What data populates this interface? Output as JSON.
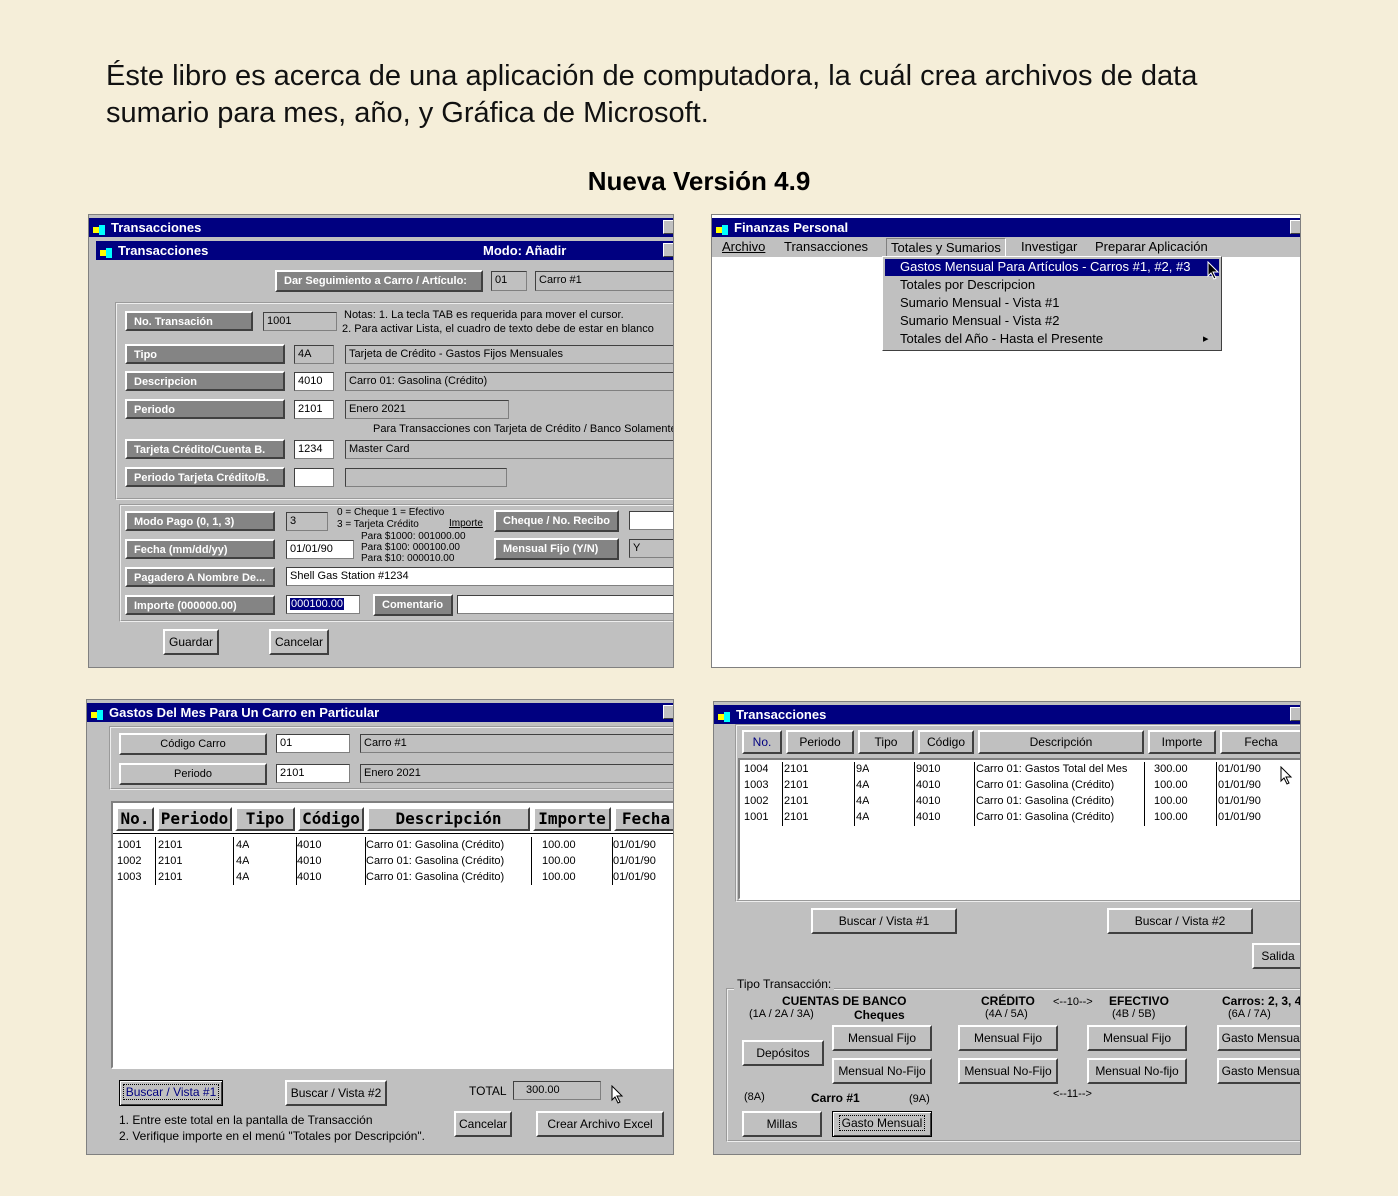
{
  "intro": {
    "line1": "Éste libro es acerca de una aplicación de computadora, la cuál crea archivos de data",
    "line2": "sumario para mes, año, y Gráfica de Microsoft."
  },
  "version": "Nueva Versión 4.9",
  "w1": {
    "outer_title": "Transacciones",
    "inner_title": "Transacciones",
    "mode": "Modo: Añadir",
    "seguimiento_label": "Dar Seguimiento a Carro / Artículo:",
    "seguimiento_code": "01",
    "seguimiento_name": "Carro #1",
    "no_trans_label": "No. Transación",
    "no_trans_value": "1001",
    "notes1": "Notas:  1.  La tecla TAB es requerida para mover el cursor.",
    "notes2": "2. Para activar Lista, el cuadro de texto debe de estar en blanco",
    "tipo_label": "Tipo",
    "tipo_code": "4A",
    "tipo_desc": "Tarjeta de Crédito - Gastos Fijos Mensuales",
    "desc_label": "Descripcion",
    "desc_code": "4010",
    "desc_value": "Carro 01: Gasolina  (Crédito)",
    "periodo_label": "Periodo",
    "periodo_code": "2101",
    "periodo_value": "Enero 2021",
    "tarjeta_note": "Para Transacciones con Tarjeta de Crédito / Banco Solamente",
    "tarjeta_label": "Tarjeta Crédito/Cuenta B.",
    "tarjeta_code": "1234",
    "tarjeta_value": "Master Card",
    "periodo_tarjeta_label": "Periodo Tarjeta Crédito/B.",
    "modo_pago_label": "Modo Pago (0, 1, 3)",
    "modo_pago_value": "3",
    "modo_note1": "0 = Cheque  1 = Efectivo",
    "modo_note2": "3 = Tarjeta Crédito",
    "importe_link": "Importe",
    "cheque_label": "Cheque / No. Recibo",
    "fecha_label": "Fecha  (mm/dd/yy)",
    "fecha_value": "01/01/90",
    "para1": "Para   $1000:   001000.00",
    "para2": "Para    $100:   000100.00",
    "para3": "Para      $10:   000010.00",
    "mensual_label": "Mensual Fijo (Y/N)",
    "mensual_value": "Y",
    "pagadero_label": "Pagadero A Nombre De...",
    "pagadero_value": "Shell Gas Station #1234",
    "importe_label": "Importe  (000000.00)",
    "importe_value": "000100.00",
    "comentario_label": "Comentario",
    "guardar": "Guardar",
    "cancelar": "Cancelar"
  },
  "w2": {
    "title": "Finanzas Personal",
    "menubar": [
      "Archivo",
      "Transacciones",
      "Totales y Sumarios",
      "Investigar",
      "Preparar Aplicación"
    ],
    "dropdown": [
      "Gastos Mensual Para  Artículos - Carros #1, #2, #3",
      "Totales por Descripcion",
      "Sumario Mensual - Vista #1",
      "Sumario Mensual - Vista #2",
      "Totales del Año - Hasta el Presente"
    ],
    "submenu_arrow": "▸"
  },
  "w3": {
    "title": "Gastos Del Mes Para Un Carro en Particular",
    "codigo_label": "Código Carro",
    "codigo_value": "01",
    "codigo_name": "Carro #1",
    "periodo_label": "Periodo",
    "periodo_value": "2101",
    "periodo_name": "Enero 2021",
    "columns": [
      "No.",
      "Periodo",
      "Tipo",
      "Código",
      "Descripción",
      "Importe",
      "Fecha"
    ],
    "rows": [
      [
        "1001",
        "2101",
        "4A",
        "4010",
        "Carro 01: Gasolina  (Crédito)",
        "100.00",
        "01/01/90"
      ],
      [
        "1002",
        "2101",
        "4A",
        "4010",
        "Carro 01: Gasolina  (Crédito)",
        "100.00",
        "01/01/90"
      ],
      [
        "1003",
        "2101",
        "4A",
        "4010",
        "Carro 01: Gasolina  (Crédito)",
        "100.00",
        "01/01/90"
      ]
    ],
    "buscar1": "Buscar / Vista #1",
    "buscar2": "Buscar / Vista #2",
    "total_label": "TOTAL",
    "total_value": "300.00",
    "note1": "1.  Entre este total en la pantalla de Transacción",
    "note2": "2.  Verifique importe en el menú \"Totales por Descripción\".",
    "cancelar": "Cancelar",
    "crear_excel": "Crear Archivo Excel"
  },
  "w4": {
    "title": "Transacciones",
    "columns": [
      "No.",
      "Periodo",
      "Tipo",
      "Código",
      "Descripción",
      "Importe",
      "Fecha"
    ],
    "rows": [
      [
        "1004",
        "2101",
        "9A",
        "9010",
        "Carro 01: Gastos Total del Mes",
        "300.00",
        "01/01/90"
      ],
      [
        "1003",
        "2101",
        "4A",
        "4010",
        "Carro 01: Gasolina  (Crédito)",
        "100.00",
        "01/01/90"
      ],
      [
        "1002",
        "2101",
        "4A",
        "4010",
        "Carro 01: Gasolina  (Crédito)",
        "100.00",
        "01/01/90"
      ],
      [
        "1001",
        "2101",
        "4A",
        "4010",
        "Carro 01: Gasolina  (Crédito)",
        "100.00",
        "01/01/90"
      ]
    ],
    "buscar1": "Buscar / Vista #1",
    "buscar2": "Buscar / Vista #2",
    "salida": "Salida",
    "tipo_trans": "Tipo Transacción:",
    "cuentas": "CUENTAS  DE  BANCO",
    "cuentas_codes": "(1A / 2A / 3A)",
    "cheques": "Cheques",
    "credito": "CRÉDITO",
    "credito_codes": "(4A / 5A)",
    "arrow10": "<--10-->",
    "efectivo": "EFECTIVO",
    "efectivo_codes": "(4B / 5B)",
    "carros": "Carros: 2,  3,  4",
    "carros_codes": "(6A / 7A)",
    "depositos": "Depósitos",
    "mensual_fijo": "Mensual Fijo",
    "mensual_nofijo1": "Mensual  No-Fijo",
    "mensual_nofijo2": "Mensual No-Fijo",
    "mensual_nofijo3": "Mensual No-fijo",
    "gasto_mensual_a": "Gasto Mensual",
    "gasto_mensual_b": "Gasto Mensual",
    "arrow11": "<--11-->",
    "code8a": "(8A)",
    "carro1": "Carro #1",
    "code9a": "(9A)",
    "millas": "Millas",
    "gasto_mensual": "Gasto Mensual"
  },
  "colors": {
    "title_bar": "#000080",
    "panel": "#c0c0c0",
    "label_bg": "#848484",
    "page_bg": "#f5eed9"
  },
  "icons": [
    "app-icon",
    "close-box-icon",
    "mouse-cursor-icon"
  ]
}
